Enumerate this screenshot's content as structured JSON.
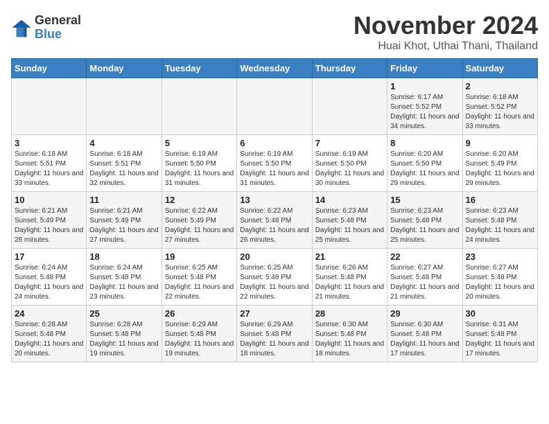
{
  "logo": {
    "general": "General",
    "blue": "Blue"
  },
  "title": "November 2024",
  "location": "Huai Khot, Uthai Thani, Thailand",
  "headers": [
    "Sunday",
    "Monday",
    "Tuesday",
    "Wednesday",
    "Thursday",
    "Friday",
    "Saturday"
  ],
  "weeks": [
    [
      {
        "day": "",
        "info": ""
      },
      {
        "day": "",
        "info": ""
      },
      {
        "day": "",
        "info": ""
      },
      {
        "day": "",
        "info": ""
      },
      {
        "day": "",
        "info": ""
      },
      {
        "day": "1",
        "info": "Sunrise: 6:17 AM\nSunset: 5:52 PM\nDaylight: 11 hours and 34 minutes."
      },
      {
        "day": "2",
        "info": "Sunrise: 6:18 AM\nSunset: 5:52 PM\nDaylight: 11 hours and 33 minutes."
      }
    ],
    [
      {
        "day": "3",
        "info": "Sunrise: 6:18 AM\nSunset: 5:51 PM\nDaylight: 11 hours and 33 minutes."
      },
      {
        "day": "4",
        "info": "Sunrise: 6:18 AM\nSunset: 5:51 PM\nDaylight: 11 hours and 32 minutes."
      },
      {
        "day": "5",
        "info": "Sunrise: 6:19 AM\nSunset: 5:50 PM\nDaylight: 11 hours and 31 minutes."
      },
      {
        "day": "6",
        "info": "Sunrise: 6:19 AM\nSunset: 5:50 PM\nDaylight: 11 hours and 31 minutes."
      },
      {
        "day": "7",
        "info": "Sunrise: 6:19 AM\nSunset: 5:50 PM\nDaylight: 11 hours and 30 minutes."
      },
      {
        "day": "8",
        "info": "Sunrise: 6:20 AM\nSunset: 5:50 PM\nDaylight: 11 hours and 29 minutes."
      },
      {
        "day": "9",
        "info": "Sunrise: 6:20 AM\nSunset: 5:49 PM\nDaylight: 11 hours and 29 minutes."
      }
    ],
    [
      {
        "day": "10",
        "info": "Sunrise: 6:21 AM\nSunset: 5:49 PM\nDaylight: 11 hours and 28 minutes."
      },
      {
        "day": "11",
        "info": "Sunrise: 6:21 AM\nSunset: 5:49 PM\nDaylight: 11 hours and 27 minutes."
      },
      {
        "day": "12",
        "info": "Sunrise: 6:22 AM\nSunset: 5:49 PM\nDaylight: 11 hours and 27 minutes."
      },
      {
        "day": "13",
        "info": "Sunrise: 6:22 AM\nSunset: 5:48 PM\nDaylight: 11 hours and 26 minutes."
      },
      {
        "day": "14",
        "info": "Sunrise: 6:23 AM\nSunset: 5:48 PM\nDaylight: 11 hours and 25 minutes."
      },
      {
        "day": "15",
        "info": "Sunrise: 6:23 AM\nSunset: 5:48 PM\nDaylight: 11 hours and 25 minutes."
      },
      {
        "day": "16",
        "info": "Sunrise: 6:23 AM\nSunset: 5:48 PM\nDaylight: 11 hours and 24 minutes."
      }
    ],
    [
      {
        "day": "17",
        "info": "Sunrise: 6:24 AM\nSunset: 5:48 PM\nDaylight: 11 hours and 24 minutes."
      },
      {
        "day": "18",
        "info": "Sunrise: 6:24 AM\nSunset: 5:48 PM\nDaylight: 11 hours and 23 minutes."
      },
      {
        "day": "19",
        "info": "Sunrise: 6:25 AM\nSunset: 5:48 PM\nDaylight: 11 hours and 22 minutes."
      },
      {
        "day": "20",
        "info": "Sunrise: 6:25 AM\nSunset: 5:48 PM\nDaylight: 11 hours and 22 minutes."
      },
      {
        "day": "21",
        "info": "Sunrise: 6:26 AM\nSunset: 5:48 PM\nDaylight: 11 hours and 21 minutes."
      },
      {
        "day": "22",
        "info": "Sunrise: 6:27 AM\nSunset: 5:48 PM\nDaylight: 11 hours and 21 minutes."
      },
      {
        "day": "23",
        "info": "Sunrise: 6:27 AM\nSunset: 5:48 PM\nDaylight: 11 hours and 20 minutes."
      }
    ],
    [
      {
        "day": "24",
        "info": "Sunrise: 6:28 AM\nSunset: 5:48 PM\nDaylight: 11 hours and 20 minutes."
      },
      {
        "day": "25",
        "info": "Sunrise: 6:28 AM\nSunset: 5:48 PM\nDaylight: 11 hours and 19 minutes."
      },
      {
        "day": "26",
        "info": "Sunrise: 6:29 AM\nSunset: 5:48 PM\nDaylight: 11 hours and 19 minutes."
      },
      {
        "day": "27",
        "info": "Sunrise: 6:29 AM\nSunset: 5:48 PM\nDaylight: 11 hours and 18 minutes."
      },
      {
        "day": "28",
        "info": "Sunrise: 6:30 AM\nSunset: 5:48 PM\nDaylight: 11 hours and 18 minutes."
      },
      {
        "day": "29",
        "info": "Sunrise: 6:30 AM\nSunset: 5:48 PM\nDaylight: 11 hours and 17 minutes."
      },
      {
        "day": "30",
        "info": "Sunrise: 6:31 AM\nSunset: 5:48 PM\nDaylight: 11 hours and 17 minutes."
      }
    ]
  ]
}
